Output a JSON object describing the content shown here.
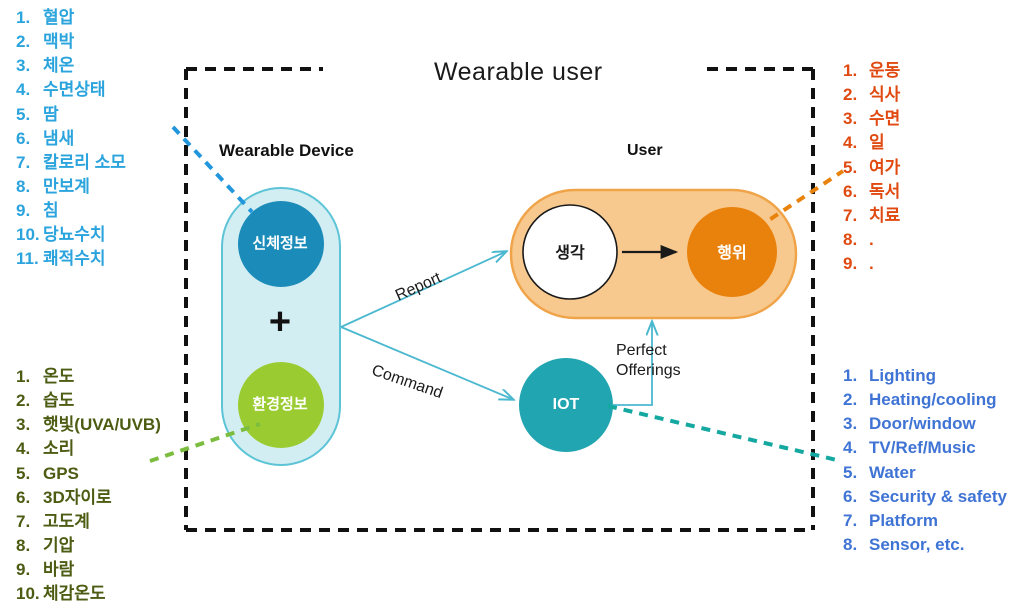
{
  "diagram": {
    "title": "Wearable user",
    "nodes": {
      "wearable_device_label": "Wearable Device",
      "user_label": "User",
      "body_info": "신체정보",
      "env_info": "환경정보",
      "plus": "+",
      "thought": "생각",
      "action": "행위",
      "iot": "IOT"
    },
    "edges": {
      "report": "Report",
      "command": "Command",
      "perfect_offerings_line1": "Perfect",
      "perfect_offerings_line2": "Offerings"
    },
    "colors": {
      "body_info_circle": "#1b8cba",
      "env_info_circle": "#9acc31",
      "device_capsule_fill": "#d3eef3",
      "device_capsule_stroke": "#5cc4d6",
      "user_capsule_fill": "#f8c98e",
      "user_capsule_stroke": "#f0a44a",
      "action_circle": "#e8820c",
      "thought_circle": "#ffffff",
      "iot_circle": "#21a5b0",
      "boundary_dash": "#111111",
      "arrow_teal": "#4ab8cf",
      "dash_blue": "#2196dd",
      "dash_green": "#7cbd3f",
      "dash_orange": "#e8820c",
      "dash_teal": "#14a8a0"
    }
  },
  "lists": {
    "body_info": {
      "color": "#2ba4dd",
      "items": [
        {
          "num": "1.",
          "text": "혈압"
        },
        {
          "num": "2.",
          "text": "맥박"
        },
        {
          "num": "3.",
          "text": "체온"
        },
        {
          "num": "4.",
          "text": "수면상태"
        },
        {
          "num": "5.",
          "text": "땀"
        },
        {
          "num": "6.",
          "text": "냄새"
        },
        {
          "num": "7.",
          "text": "칼로리 소모"
        },
        {
          "num": "8.",
          "text": "만보계"
        },
        {
          "num": "9.",
          "text": "침"
        },
        {
          "num": "10.",
          "text": "당뇨수치"
        },
        {
          "num": "11.",
          "text": "쾌적수치"
        }
      ]
    },
    "env_info": {
      "color": "#4d5c13",
      "items": [
        {
          "num": "1.",
          "text": "온도"
        },
        {
          "num": "2.",
          "text": "습도"
        },
        {
          "num": "3.",
          "text": "햇빛(UVA/UVB)"
        },
        {
          "num": "4.",
          "text": "소리"
        },
        {
          "num": "5.",
          "text": "GPS"
        },
        {
          "num": "6.",
          "text": "3D자이로"
        },
        {
          "num": "7.",
          "text": "고도계"
        },
        {
          "num": "8.",
          "text": "기압"
        },
        {
          "num": "9.",
          "text": "바람"
        },
        {
          "num": "10.",
          "text": "체감온도"
        }
      ]
    },
    "user_action": {
      "color": "#e04a10",
      "items": [
        {
          "num": "1.",
          "text": "운동"
        },
        {
          "num": "2.",
          "text": "식사"
        },
        {
          "num": "3.",
          "text": "수면"
        },
        {
          "num": "4.",
          "text": "일"
        },
        {
          "num": "5.",
          "text": "여가"
        },
        {
          "num": "6.",
          "text": "독서"
        },
        {
          "num": "7.",
          "text": "치료"
        },
        {
          "num": "8.",
          "text": "."
        },
        {
          "num": "9.",
          "text": "."
        }
      ]
    },
    "iot_service": {
      "color": "#3f73d4",
      "items": [
        {
          "num": "1.",
          "text": "Lighting"
        },
        {
          "num": "2.",
          "text": "Heating/cooling"
        },
        {
          "num": "3.",
          "text": "Door/window"
        },
        {
          "num": "4.",
          "text": "TV/Ref/Music"
        },
        {
          "num": "5.",
          "text": "Water"
        },
        {
          "num": "6.",
          "text": "Security & safety"
        },
        {
          "num": "7.",
          "text": "Platform"
        },
        {
          "num": "8.",
          "text": "Sensor, etc."
        }
      ]
    }
  }
}
